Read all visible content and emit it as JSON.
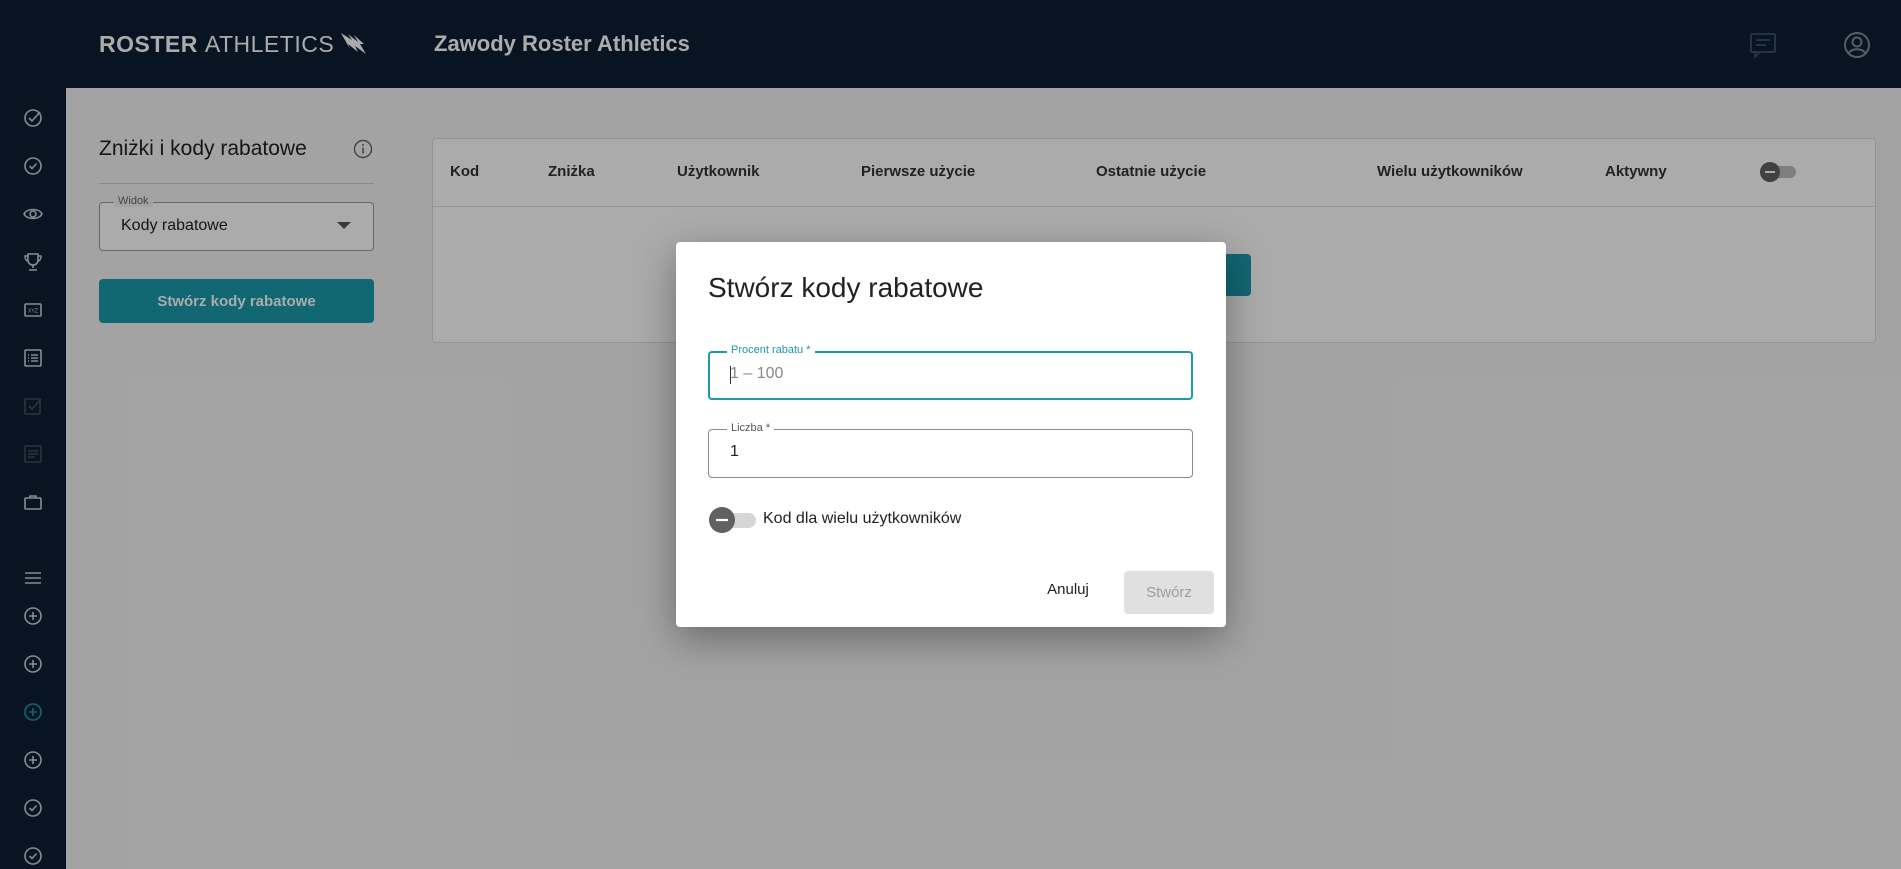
{
  "brand": {
    "part1": "ROSTER",
    "part2": "ATHLETICS"
  },
  "app_title": "Zawody Roster Athletics",
  "sidebar": {
    "items": [
      {
        "icon": "check-circle-icon"
      },
      {
        "icon": "check-circle-icon"
      },
      {
        "icon": "eye-icon"
      },
      {
        "icon": "trophy-icon"
      },
      {
        "icon": "bib-icon"
      },
      {
        "icon": "list-icon"
      },
      {
        "icon": "checkbox-icon"
      },
      {
        "icon": "document-icon"
      },
      {
        "icon": "briefcase-icon"
      },
      {
        "icon": "menu-icon"
      },
      {
        "icon": "plus-circle-icon"
      },
      {
        "icon": "plus-circle-icon"
      },
      {
        "icon": "plus-circle-icon",
        "active": true
      },
      {
        "icon": "plus-circle-icon"
      },
      {
        "icon": "check-circle-icon"
      },
      {
        "icon": "check-circle-icon"
      }
    ],
    "active_color": "#1a9aab"
  },
  "panel": {
    "title": "Zniżki i kody rabatowe",
    "view_legend": "Widok",
    "view_value": "Kody rabatowe",
    "create_button": "Stwórz kody rabatowe"
  },
  "table": {
    "headers": [
      "Kod",
      "Zniżka",
      "Użytkownik",
      "Pierwsze użycie",
      "Ostatnie użycie",
      "Wielu użytkowników",
      "Aktywny"
    ]
  },
  "dialog": {
    "title": "Stwórz kody rabatowe",
    "percent_label": "Procent rabatu *",
    "percent_placeholder": "1 – 100",
    "count_label": "Liczba *",
    "count_value": "1",
    "multi_user_label": "Kod dla wielu użytkowników",
    "cancel_label": "Anuluj",
    "submit_label": "Stwórz"
  },
  "colors": {
    "topbar": "#0c1f33",
    "accent": "#1a9aab",
    "disabled_bg": "#e0e0e0"
  }
}
